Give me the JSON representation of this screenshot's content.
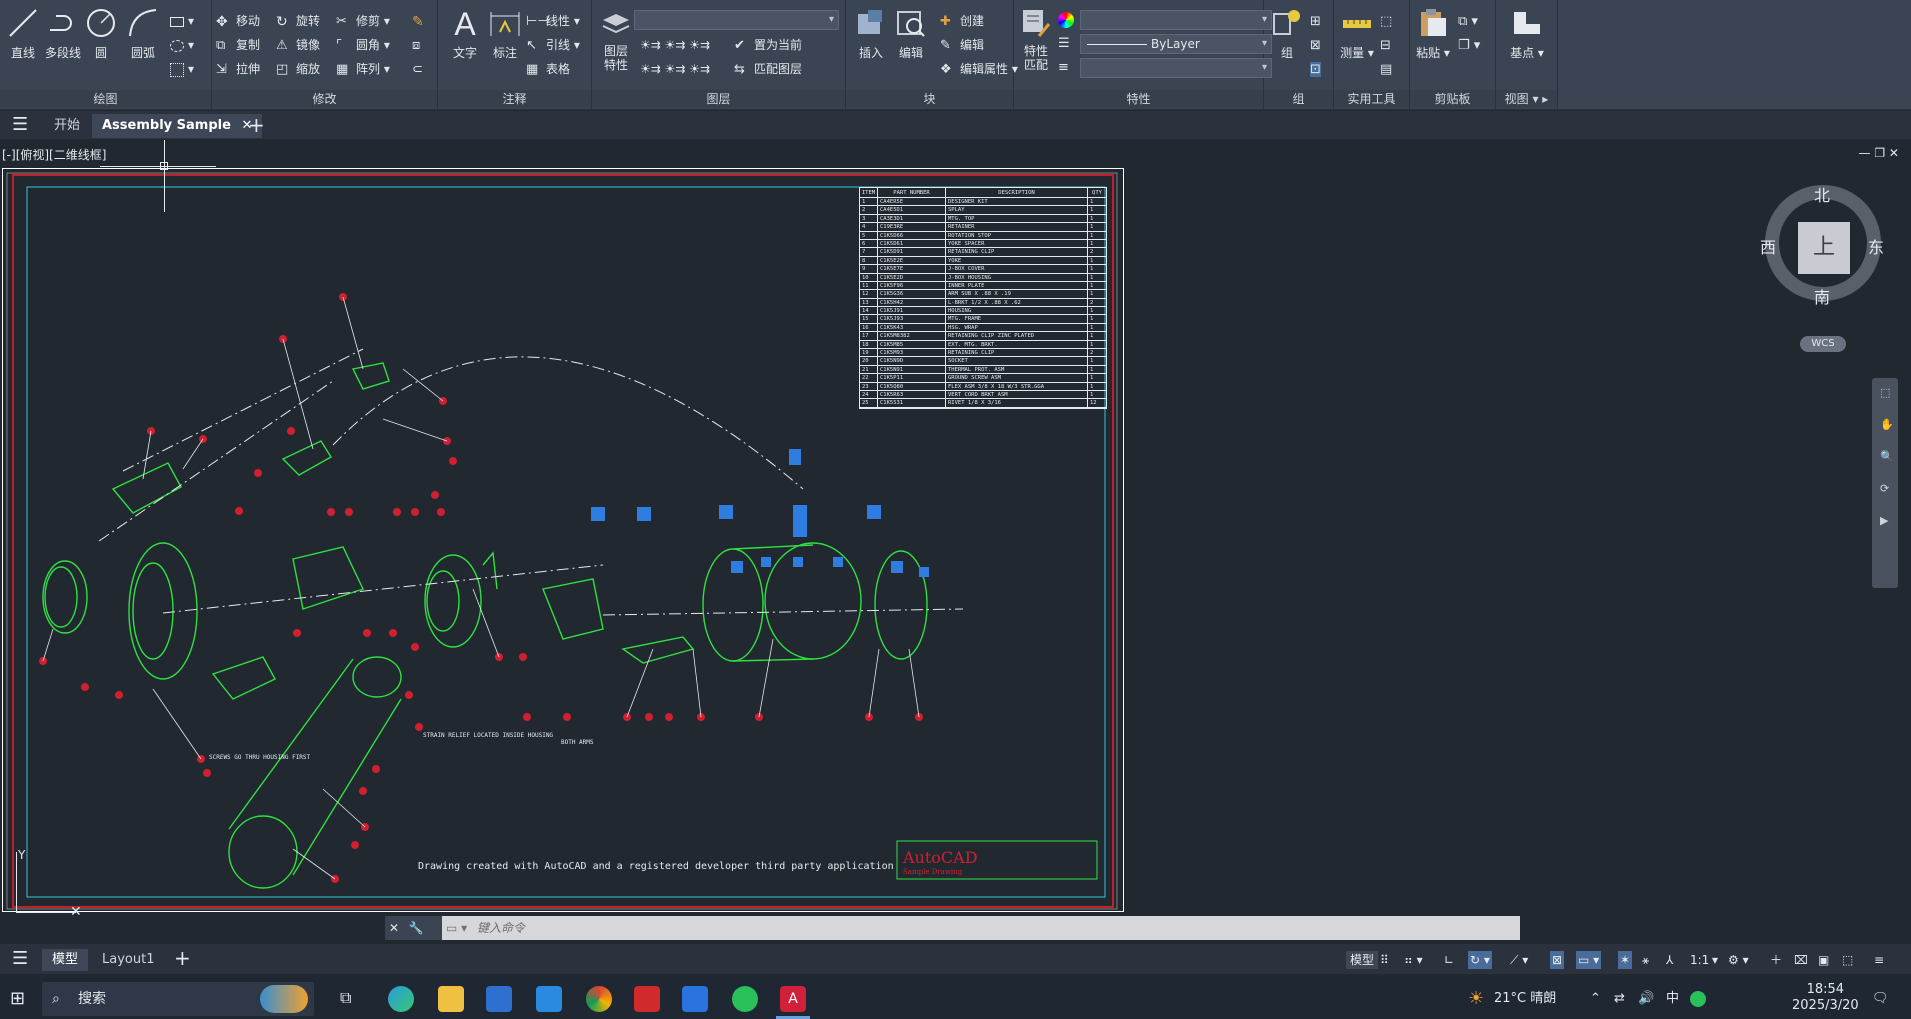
{
  "ribbon": {
    "draw": {
      "title": "绘图",
      "line": "直线",
      "polyline": "多段线",
      "circle": "圆",
      "arc": "圆弧"
    },
    "modify": {
      "title": "修改",
      "move": "移动",
      "rotate": "旋转",
      "trim": "修剪",
      "copy": "复制",
      "mirror": "镜像",
      "fillet": "圆角",
      "stretch": "拉伸",
      "scale": "缩放",
      "array": "阵列"
    },
    "annotation": {
      "title": "注释",
      "text": "文字",
      "dimension": "标注",
      "linear": "线性",
      "leader": "引线",
      "table": "表格"
    },
    "layers": {
      "title": "图层",
      "properties": "图层特性",
      "set_current": "置为当前",
      "match": "匹配图层"
    },
    "block": {
      "title": "块",
      "insert": "插入",
      "edit": "编辑",
      "create": "创建",
      "edit2": "编辑",
      "edit_attr": "编辑属性"
    },
    "properties": {
      "title": "特性",
      "match": "特性匹配",
      "bylayer": "ByLayer"
    },
    "groups": {
      "title": "组",
      "group": "组"
    },
    "utilities": {
      "title": "实用工具",
      "measure": "测量"
    },
    "clipboard": {
      "title": "剪贴板",
      "paste": "粘贴"
    },
    "view": {
      "title": "视图",
      "base": "基点"
    }
  },
  "tabs": {
    "start": "开始",
    "doc": "Assembly Sample"
  },
  "viewport": {
    "label": "[-][俯视][二维线框]"
  },
  "viewcube": {
    "north": "北",
    "south": "南",
    "east": "东",
    "west": "西",
    "top": "上",
    "wcs": "WCS"
  },
  "drawing": {
    "footer_text": "Drawing created with AutoCAD and a registered developer third party application",
    "logo": "AutoCAD",
    "logo_sub": "Sample Drawing",
    "note_strain": "STRAIN RELIEF LOCATED INSIDE HOUSING",
    "note_screws": "SCREWS GO THRU HOUSING FIRST",
    "note_both": "BOTH ARMS",
    "bom_headers": [
      "ITEM",
      "PART NUMBER",
      "DESCRIPTION",
      "QTY"
    ],
    "bom_rows": [
      [
        "1",
        "CA4ER5E",
        "DESIGNER KIT",
        "1"
      ],
      [
        "2",
        "CA4E5D1",
        "SPLAY",
        "1"
      ],
      [
        "3",
        "CA3E3D1",
        "MTG. TOP",
        "1"
      ],
      [
        "4",
        "C19E3RE",
        "RETAINER",
        "1"
      ],
      [
        "5",
        "C1K5D66",
        "ROTATION STOP",
        "1"
      ],
      [
        "6",
        "C1K5D61",
        "YOKE SPACER",
        "1"
      ],
      [
        "7",
        "C1K5D91",
        "RETAINING CLIP",
        "2"
      ],
      [
        "8",
        "C1K5E2E",
        "YOKE",
        "1"
      ],
      [
        "9",
        "C1K5E7E",
        "J-BOX COVER",
        "1"
      ],
      [
        "10",
        "C1K5E2D",
        "J-BOX HOUSING",
        "1"
      ],
      [
        "11",
        "C1K5F96",
        "INNER PLATE",
        "1"
      ],
      [
        "12",
        "C1K5G36",
        "ARM SUB X .88 X .19",
        "1"
      ],
      [
        "13",
        "C1K5H42",
        "L-BRKT 1/2 X .88 X .62",
        "2"
      ],
      [
        "14",
        "C1K5J91",
        "HOUSING",
        "1"
      ],
      [
        "15",
        "C1K5J93",
        "MTG. FRAME",
        "1"
      ],
      [
        "16",
        "C1K5K43",
        "HSG. WRAP",
        "1"
      ],
      [
        "17",
        "C1K5M8382",
        "RETAINING CLIP ZINC PLATED",
        "1"
      ],
      [
        "18",
        "C1K5M85",
        "EXT. MTG. BRKT.",
        "1"
      ],
      [
        "19",
        "C1K5M93",
        "RETAINING CLIP",
        "2"
      ],
      [
        "20",
        "C1K5N9D",
        "SOCKET",
        "1"
      ],
      [
        "21",
        "C1K5N91",
        "THERMAL PROT. ASM",
        "1"
      ],
      [
        "22",
        "C1K5P11",
        "GROUND SCREW ASM",
        "1"
      ],
      [
        "23",
        "C1K5Q80",
        "FLEX ASM 3/8 X 18 W/3 STR.GGA",
        "1"
      ],
      [
        "24",
        "C1K5R63",
        "VERT CORD BRKT ASM",
        "1"
      ],
      [
        "25",
        "C1K5S31",
        "RIVET 1/8 X 3/16",
        "12"
      ]
    ]
  },
  "command": {
    "placeholder": "键入命令"
  },
  "layout_tabs": {
    "model": "模型",
    "layout1": "Layout1"
  },
  "status": {
    "model": "模型",
    "scale": "1:1"
  },
  "taskbar": {
    "search": "搜索",
    "weather": "21°C 晴朗",
    "ime": "中",
    "time": "18:54",
    "date": "2025/3/20"
  }
}
